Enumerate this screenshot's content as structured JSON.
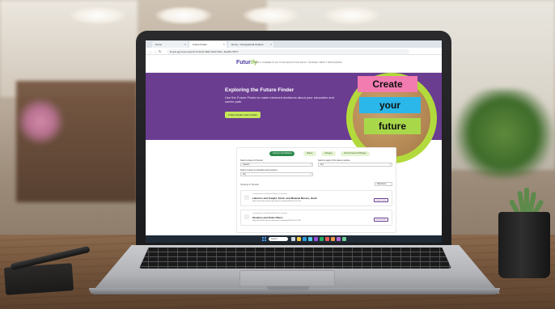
{
  "browser": {
    "tabs": [
      {
        "label": "Home"
      },
      {
        "label": "Future Finder"
      },
      {
        "label": "Home - Occupational Outlook"
      }
    ],
    "url": "fil.pub.ag.in/occ.aspx?c=3.4/111 6843 4343 3321, 5u&#8.77877"
  },
  "site": {
    "logo_main": "Futur",
    "logo_accent": "ify",
    "nav": "FIND A CAREER   PLAN YOUR EDUCATION   ADULT JOURNEY   ABOUT   RESOURCES"
  },
  "hero": {
    "title": "Exploring the Future Finder",
    "description": "Use the Future Finder to make informed decisions about your education and career path.",
    "cta_label": "Future Finder Learn Guide"
  },
  "promo": {
    "word1": "Create",
    "word2": "your",
    "word3": "future"
  },
  "panel": {
    "pills": [
      {
        "label": "Careers and Salaries",
        "active": true
      },
      {
        "label": "Majors",
        "active": false
      },
      {
        "label": "Colleges",
        "active": false
      },
      {
        "label": "School Career Pathways",
        "active": false
      }
    ],
    "q1_label": "Select a Career of Interest",
    "q1_value": "Careers",
    "q2_label": "Select a region of the state to explore",
    "q2_value": "Any",
    "q3_label": "Select a career by education level required",
    "q3_value": "Any",
    "results_label": "Showing 47 Results",
    "sort_value": "Relevance",
    "cards": [
      {
        "category": "Transportation and Material Moving Occupations",
        "title": "Laborers and Freight, Stock, and Material Movers, Hand",
        "meta": "High School     No formal educational credential     $33,010     14,754",
        "button": "View Details"
      },
      {
        "category": "Transportation and Material Moving Occupations",
        "title": "Stockers and Order Fillers",
        "meta": "High School     No formal educational credential     $32,020     12,138",
        "button": "View Details"
      }
    ]
  },
  "taskbar": {
    "search_label": "Search"
  }
}
